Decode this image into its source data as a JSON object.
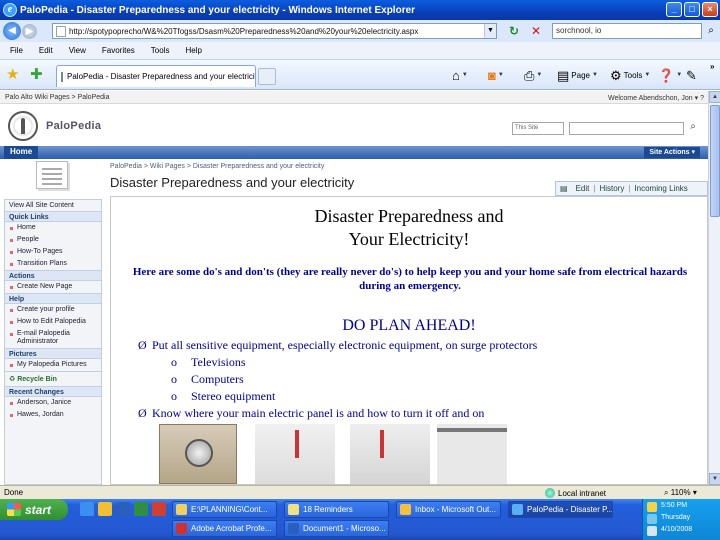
{
  "browser": {
    "title": "PaloPedia - Disaster Preparedness and your electricity - Windows Internet Explorer",
    "url": "http://spotypoprecho/W&%20Tfogss/Dsasm%20Preparedness%20and%20your%20electricity.aspx",
    "search_value": "sorchnool, io",
    "menu": [
      "File",
      "Edit",
      "View",
      "Favorites",
      "Tools",
      "Help"
    ],
    "tab_label": "PaloPedia - Disaster Preparedness and your electricity",
    "cmd_page": "Page",
    "cmd_tools": "Tools",
    "more": "»"
  },
  "sharepoint": {
    "top_links": "Palo Alto Wiki Pages > PaloPedia",
    "welcome": "Welcome Abendschon, Jon",
    "site_name": "PaloPedia",
    "scope": "This Site",
    "nav_home": "Home",
    "site_actions": "Site Actions",
    "breadcrumb": "PaloPedia > Wiki Pages > Disaster Preparedness and your electricity",
    "page_title": "Disaster Preparedness and your electricity",
    "edit_links": [
      "Edit",
      "History",
      "Incoming Links"
    ]
  },
  "quick_launch": {
    "view_all": "View All Site Content",
    "sections": [
      {
        "head": "Quick Links",
        "items": [
          "Home",
          "People",
          "How-To Pages",
          "Transition Plans"
        ]
      },
      {
        "head": "Actions",
        "items": [
          "Create New Page"
        ]
      },
      {
        "head": "Help",
        "items": [
          "Create your profile",
          "How to Edit Palopedia",
          "E-mail Palopedia Administrator"
        ]
      },
      {
        "head": "Pictures",
        "items": [
          "My Palopedia Pictures"
        ]
      }
    ],
    "recycle": "Recycle Bin",
    "recent_head": "Recent Changes",
    "recent_items": [
      "Anderson, Janice",
      "Hawes, Jordan"
    ]
  },
  "document": {
    "title_line1": "Disaster Preparedness and",
    "title_line2": "Your Electricity!",
    "lead": "Here are some do's and don'ts (they are really never do's) to help keep you and your home safe from electrical hazards during an emergency.",
    "section": "DO PLAN AHEAD!",
    "bullet1": "Put all sensitive equipment, especially electronic equipment, on surge protectors",
    "sub_items": [
      "Televisions",
      "Computers",
      "Stereo equipment"
    ],
    "bullet2": "Know where your main electric panel is and how to turn it off and on",
    "arrow": "Ø",
    "sub_marker": "o"
  },
  "status": {
    "done": "Done",
    "zone": "Local intranet",
    "zoom": "110%"
  },
  "taskbar": {
    "start": "start",
    "tasks": [
      "E:\\PLANNING\\Cont...",
      "18 Reminders",
      "Inbox - Microsoft Out...",
      "PaloPedia - Disaster P...",
      "Adobe Acrobat Profe...",
      "Document1 - Microso..."
    ],
    "clock_time": "5:50 PM",
    "clock_day": "Thursday",
    "clock_date": "4/10/2008"
  },
  "colors": {
    "doc_text": "#000099",
    "titlebar": "#0a4fd0",
    "start_green": "#3a9a3a"
  }
}
